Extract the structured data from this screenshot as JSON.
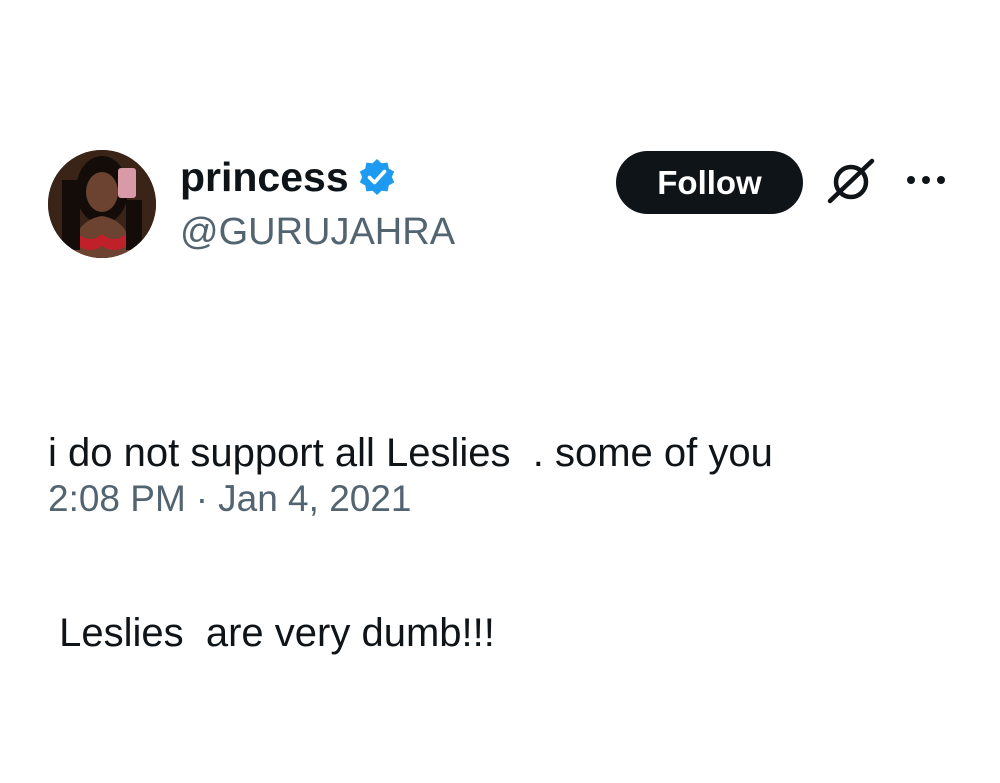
{
  "author": {
    "display_name": "princess",
    "handle": "@GURUJAHRA",
    "verified": true,
    "verified_badge_color": "#1d9bf0",
    "avatar_icon": "profile-photo"
  },
  "actions": {
    "follow_label": "Follow",
    "grok_icon": "grok-slash-circle-icon",
    "more_icon": "more-options-icon"
  },
  "tweet": {
    "lines": [
      "i do not support all Leslies  . some of you",
      " Leslies  are very dumb!!!"
    ]
  },
  "meta": {
    "time": "2:08 PM",
    "separator": "·",
    "date": "Jan 4, 2021"
  },
  "colors": {
    "text_primary": "#0f1419",
    "text_secondary": "#536471",
    "follow_bg": "#0f1419",
    "follow_text": "#ffffff"
  }
}
